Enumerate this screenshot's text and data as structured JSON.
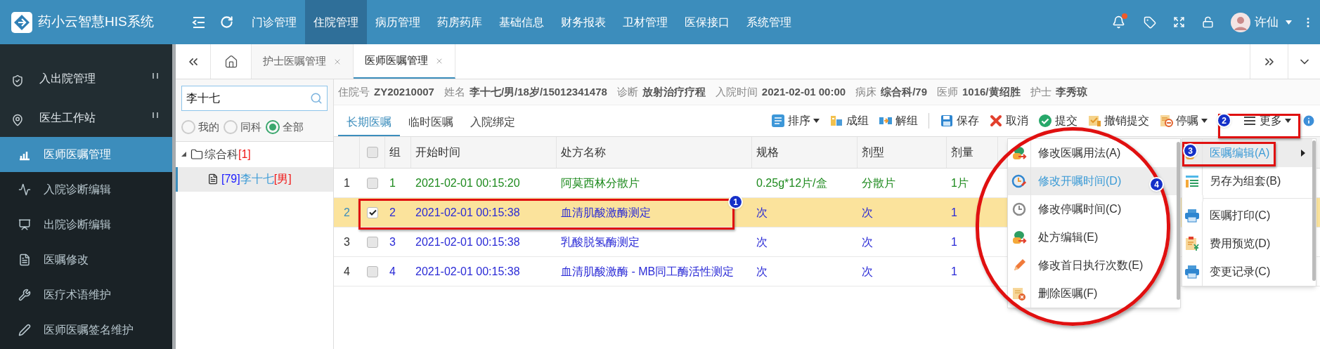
{
  "app": {
    "title": "药小云智慧HIS系统",
    "bell_unread": true
  },
  "nav": [
    {
      "label": "门诊管理",
      "selected": false
    },
    {
      "label": "住院管理",
      "selected": true
    },
    {
      "label": "病历管理",
      "selected": false
    },
    {
      "label": "药房药库",
      "selected": false
    },
    {
      "label": "基础信息",
      "selected": false
    },
    {
      "label": "财务报表",
      "selected": false
    },
    {
      "label": "卫材管理",
      "selected": false
    },
    {
      "label": "医保接口",
      "selected": false
    },
    {
      "label": "系统管理",
      "selected": false
    }
  ],
  "user": {
    "name": "许仙"
  },
  "sidebar": {
    "groups": [
      {
        "label": "入出院管理"
      },
      {
        "label": "医生工作站",
        "items": [
          {
            "label": "医师医嘱管理",
            "selected": true
          },
          {
            "label": "入院诊断编辑",
            "selected": false
          },
          {
            "label": "出院诊断编辑",
            "selected": false
          },
          {
            "label": "医嘱修改",
            "selected": false
          },
          {
            "label": "医疗术语维护",
            "selected": false
          },
          {
            "label": "医师医嘱签名维护",
            "selected": false
          }
        ]
      }
    ]
  },
  "page_tabs": [
    {
      "label": "护士医嘱管理",
      "selected": false
    },
    {
      "label": "医师医嘱管理",
      "selected": true
    }
  ],
  "patient_search": {
    "value": "李十七"
  },
  "scope_filter": [
    {
      "label": "我的",
      "selected": false
    },
    {
      "label": "同科",
      "selected": false
    },
    {
      "label": "全部",
      "selected": true
    }
  ],
  "tree": [
    {
      "label": "综合科",
      "count": "[1]",
      "expanded": true,
      "children": [
        {
          "bed": "[79]",
          "name": "李十七",
          "sex": "[男]",
          "selected": true
        }
      ]
    }
  ],
  "patient_info": [
    {
      "label": "住院号",
      "value": "ZY20210007"
    },
    {
      "label": "姓名",
      "value": "李十七/男/18岁/15012341478"
    },
    {
      "label": "诊断",
      "value": "放射治疗疗程"
    },
    {
      "label": "入院时间",
      "value": "2021-02-01 00:00"
    },
    {
      "label": "病床",
      "value": "综合科/79"
    },
    {
      "label": "医师",
      "value": "1016/黄绍胜"
    },
    {
      "label": "护士",
      "value": "李秀琼"
    }
  ],
  "order_tabs": [
    {
      "label": "长期医嘱",
      "selected": true
    },
    {
      "label": "临时医嘱",
      "selected": false
    },
    {
      "label": "入院绑定",
      "selected": false
    }
  ],
  "toolbar": [
    {
      "label": "排序",
      "dropdown": true
    },
    {
      "label": "成组"
    },
    {
      "label": "解组"
    },
    {
      "label": "保存",
      "divider_before": true
    },
    {
      "label": "取消"
    },
    {
      "label": "提交"
    },
    {
      "label": "撤销提交"
    },
    {
      "label": "停嘱",
      "dropdown": true
    },
    {
      "label": "更多",
      "dropdown": true
    }
  ],
  "table": {
    "all_checked": false,
    "columns": [
      "组",
      "开始时间",
      "处方名称",
      "规格",
      "剂型",
      "剂量"
    ],
    "rows": [
      {
        "no": "1",
        "checked": false,
        "selected": false,
        "color": "#1e8a1e",
        "cells": [
          "1",
          "2021-02-01 00:15:20",
          "阿莫西林分散片",
          "0.25g*12片/盒",
          "分散片",
          "1片"
        ]
      },
      {
        "no": "2",
        "checked": true,
        "selected": true,
        "color": "#2a2ad6",
        "cells": [
          "2",
          "2021-02-01 00:15:38",
          "血清肌酸激酶测定",
          "次",
          "次",
          "1"
        ]
      },
      {
        "no": "3",
        "checked": false,
        "selected": false,
        "color": "#2a2ad6",
        "cells": [
          "3",
          "2021-02-01 00:15:38",
          "乳酸脱氢酶测定",
          "次",
          "次",
          "1"
        ]
      },
      {
        "no": "4",
        "checked": false,
        "selected": false,
        "color": "#2a2ad6",
        "cells": [
          "4",
          "2021-02-01 00:15:38",
          "血清肌酸激酶 - MB同工酶活性测定",
          "次",
          "次",
          "1"
        ]
      }
    ]
  },
  "context_menu": [
    {
      "label": "修改医嘱用法(A)",
      "selected": false
    },
    {
      "label": "修改开嘱时间(D)",
      "selected": true
    },
    {
      "label": "修改停嘱时间(C)",
      "selected": false
    },
    {
      "label": "处方编辑(E)",
      "selected": false
    },
    {
      "label": "修改首日执行次数(E)",
      "selected": false
    },
    {
      "label": "删除医嘱(F)",
      "selected": false
    }
  ],
  "more_menu": [
    {
      "label": "医嘱编辑(A)",
      "selected": true,
      "submenu": true
    },
    {
      "label": "另存为组套(B)",
      "selected": false
    },
    {
      "label": "医嘱打印(C)",
      "selected": false,
      "divider_before": true
    },
    {
      "label": "费用预览(D)",
      "selected": false
    },
    {
      "label": "变更记录(C)",
      "selected": false
    }
  ],
  "annotations": [
    {
      "number": "1"
    },
    {
      "number": "2"
    },
    {
      "number": "3"
    },
    {
      "number": "4"
    }
  ]
}
